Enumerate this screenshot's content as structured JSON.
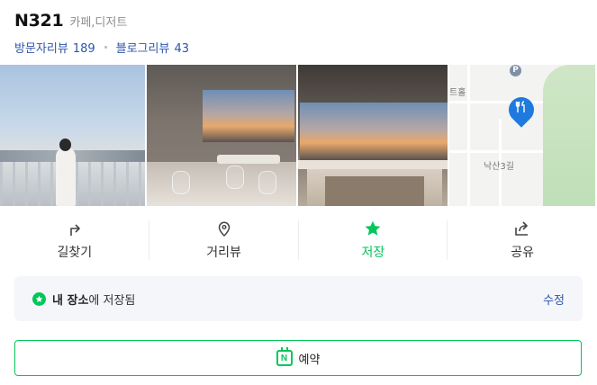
{
  "place": {
    "name": "N321",
    "category": "카페,디저트",
    "visitor_reviews_label": "방문자리뷰",
    "visitor_reviews_count": "189",
    "blog_reviews_label": "블로그리뷰",
    "blog_reviews_count": "43"
  },
  "photos": [
    {
      "icon": "photo-terrace"
    },
    {
      "icon": "photo-interior-sunset"
    },
    {
      "icon": "photo-interior-window"
    },
    {
      "icon": "map-thumbnail"
    }
  ],
  "map": {
    "label_top": "트홀",
    "label_bottom": "낙산3길",
    "parking_badge": "P"
  },
  "actions": [
    {
      "label": "길찾기",
      "icon": "directions-icon"
    },
    {
      "label": "거리뷰",
      "icon": "streetview-icon"
    },
    {
      "label": "저장",
      "icon": "star-icon"
    },
    {
      "label": "공유",
      "icon": "share-icon"
    }
  ],
  "saved": {
    "prefix": "내 장소",
    "suffix": "에 저장됨",
    "edit_label": "수정"
  },
  "reserve": {
    "label": "예약",
    "badge": "N"
  },
  "colors": {
    "accent_green": "#03c75a",
    "link_blue": "#2c55a8",
    "map_pin": "#1f7ae0"
  }
}
